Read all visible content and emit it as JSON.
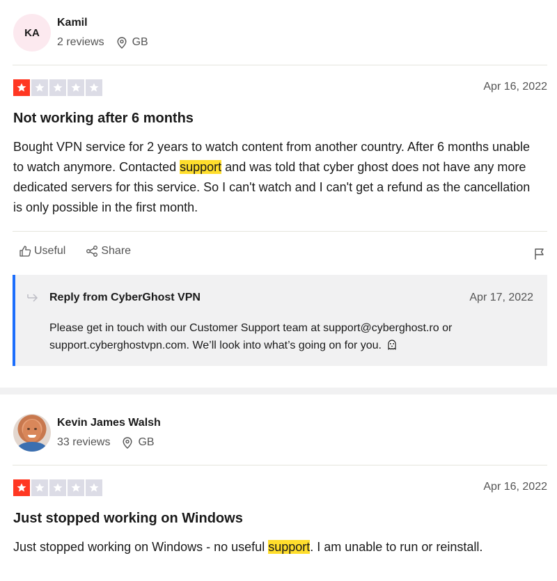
{
  "reviews": [
    {
      "consumer": {
        "initials": "KA",
        "name": "Kamil",
        "reviews_count": "2 reviews",
        "country": "GB"
      },
      "rating": 1,
      "date": "Apr 16, 2022",
      "title": "Not working after 6 months",
      "body_before": "Bought VPN service for 2 years to watch content from another country. After 6 months unable to watch anymore. Contacted ",
      "body_highlight": "support",
      "body_after": " and was told that cyber ghost does not have any more dedicated servers for this service. So I can't watch and I can't get a refund as the cancellation is only possible in the first month.",
      "actions": {
        "useful": "Useful",
        "share": "Share"
      },
      "reply": {
        "from": "Reply from CyberGhost VPN",
        "date": "Apr 17, 2022",
        "text": "Please get in touch with our Customer Support team at support@cyberghost.ro or support.cyberghostvpn.com. We’ll look into what’s going on for you."
      }
    },
    {
      "consumer": {
        "name": "Kevin James Walsh",
        "reviews_count": "33 reviews",
        "country": "GB"
      },
      "rating": 1,
      "date": "Apr 16, 2022",
      "title": "Just stopped working on Windows",
      "body_before": "Just stopped working on Windows - no useful ",
      "body_highlight": "support",
      "body_after": ". I am unable to run or reinstall."
    }
  ],
  "colors": {
    "star_filled": "#ff3722",
    "star_empty": "#dcdce6",
    "highlight": "#ffde2c",
    "reply_accent": "#1c6efc"
  },
  "icons": {
    "location": "map-pin-icon",
    "useful": "thumbs-up-icon",
    "share": "share-icon",
    "flag": "flag-icon",
    "reply": "reply-arrow-icon",
    "emoji": "ghost-emoji-icon"
  }
}
